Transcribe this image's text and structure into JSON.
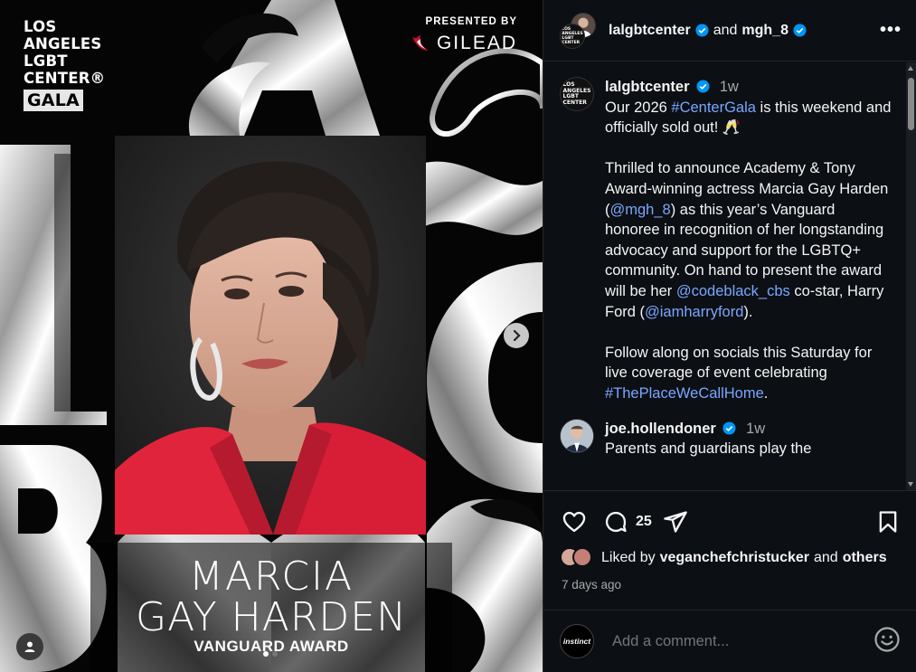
{
  "media": {
    "logo": {
      "line1": "LOS",
      "line2": "ANGELES",
      "line3": "LGBT",
      "line4": "CENTER®",
      "badge": "GALA"
    },
    "sponsor": {
      "presented_by": "PRESENTED BY",
      "name": "GILEAD"
    },
    "honoree_line1": "MARCIA",
    "honoree_line2": "GAY HARDEN",
    "award": "VANGUARD AWARD",
    "carousel": {
      "slides": 2,
      "current": 1
    }
  },
  "header": {
    "account1": "lalgbtcenter",
    "joiner": "and",
    "account2": "mgh_8",
    "more": "•••",
    "mini_logo": [
      "LOS",
      "ANGELES",
      "LGBT",
      "CENTER"
    ]
  },
  "post": {
    "username": "lalgbtcenter",
    "time": "1w",
    "p1_a": "Our 2026 ",
    "p1_tag": "#CenterGala",
    "p1_b": " is this weekend and officially sold out! 🥂",
    "p2_a": "Thrilled to announce Academy & Tony Award-winning actress Marcia Gay Harden (",
    "p2_mention1": "@mgh_8",
    "p2_b": ") as this year’s Vanguard honoree in recognition of her longstanding advocacy and support for the LGBTQ+ community. On hand to present the award will be her ",
    "p2_mention2": "@codeblack_cbs",
    "p2_c": " co-star, Harry Ford (",
    "p2_mention3": "@iamharryford",
    "p2_d": ").",
    "p3_a": "Follow along on socials this Saturday for live coverage of event celebrating ",
    "p3_tag": "#ThePlaceWeCallHome",
    "p3_b": "."
  },
  "comment": {
    "username": "joe.hollendoner",
    "time": "1w",
    "text": "Parents and guardians play the"
  },
  "actions": {
    "comment_count": "25",
    "liked_by": "Liked by",
    "liked_user": "veganchefchristucker",
    "and": "and",
    "others": "others",
    "posted_ago": "7 days ago"
  },
  "composer": {
    "avatar_label": "instinct",
    "placeholder": "Add a comment..."
  },
  "colors": {
    "link": "#7aa7ff",
    "verified": "#0095f6",
    "panel_bg": "#0c0f14",
    "jacket": "#e0243c",
    "gilead_red": "#c8102e"
  }
}
